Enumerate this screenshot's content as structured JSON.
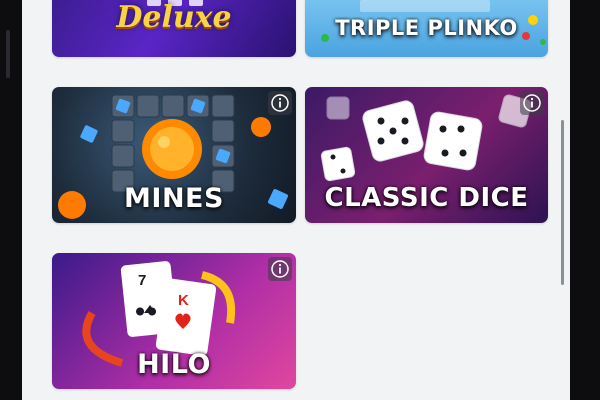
{
  "games": [
    {
      "id": "hilo-deluxe",
      "title": "Deluxe",
      "info_icon": "info-icon"
    },
    {
      "id": "triple-plinko",
      "title": "TRIPLE PLINKO"
    },
    {
      "id": "mines",
      "title": "MINES",
      "info_icon": "info-icon"
    },
    {
      "id": "classic-dice",
      "title": "CLASSIC DICE",
      "info_icon": "info-icon"
    },
    {
      "id": "hilo",
      "title": "HILO",
      "info_icon": "info-icon",
      "cards": {
        "card_a": "7",
        "card_b": "K"
      }
    }
  ],
  "colors": {
    "background": "#f2f3f5",
    "deluxe_gold": "#f7d34a",
    "dice_bg": "#7a1f6e",
    "hilo_bg": "#b02ea6"
  }
}
